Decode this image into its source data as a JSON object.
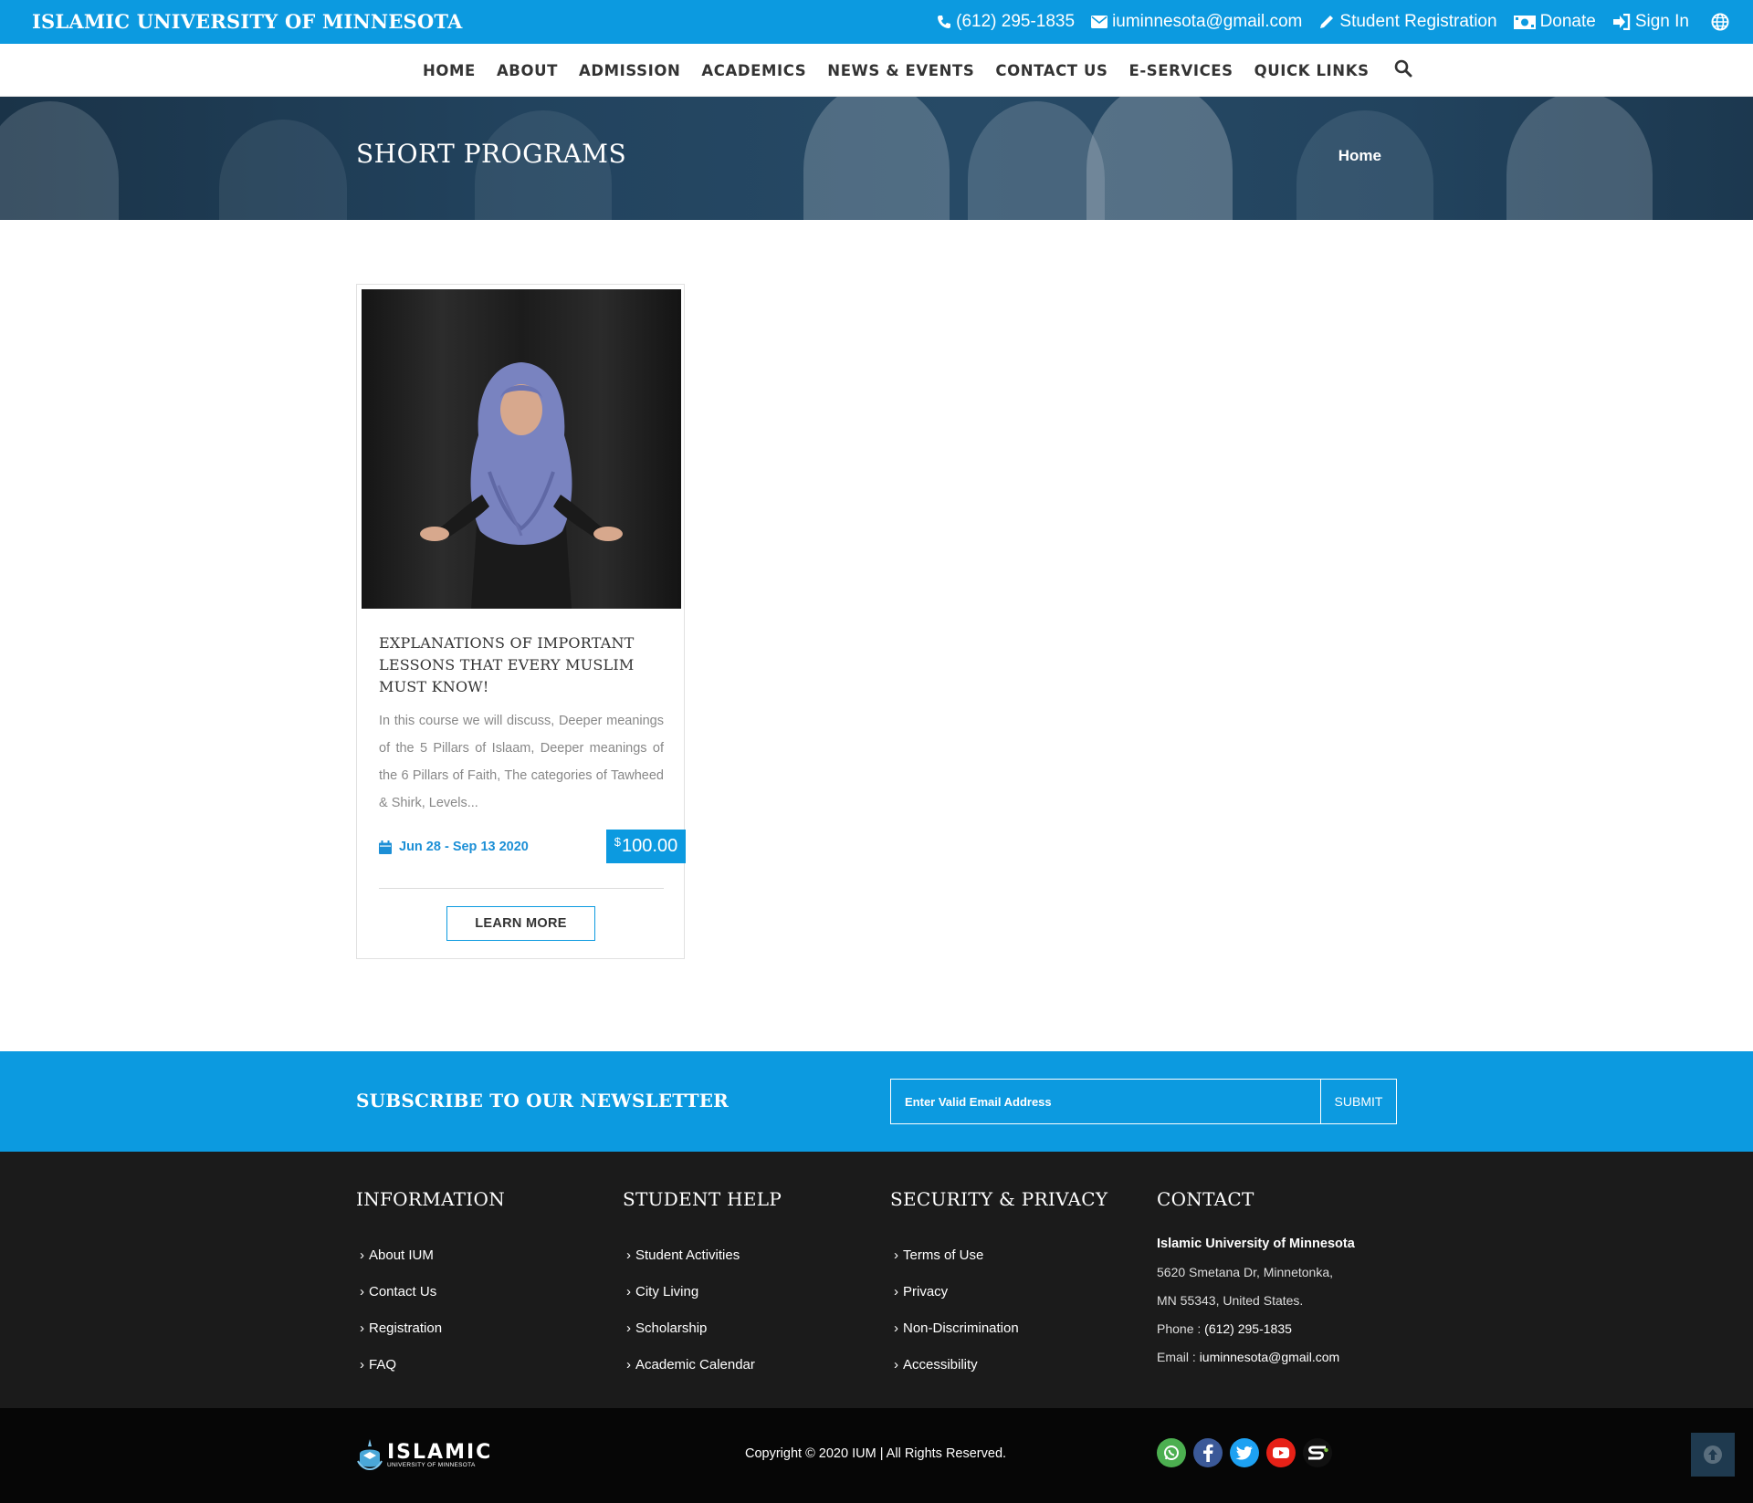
{
  "topbar": {
    "brand": "ISLAMIC UNIVERSITY OF MINNESOTA",
    "phone": "(612) 295-1835",
    "email": "iuminnesota@gmail.com",
    "registration": "Student Registration",
    "donate": "Donate",
    "signin": "Sign In"
  },
  "nav": {
    "items": [
      "HOME",
      "ABOUT",
      "ADMISSION",
      "ACADEMICS",
      "NEWS & EVENTS",
      "CONTACT US",
      "E-SERVICES",
      "QUICK LINKS"
    ]
  },
  "banner": {
    "title": "SHORT PROGRAMS",
    "breadcrumb": "Home"
  },
  "course": {
    "title": "EXPLANATIONS OF IMPORTANT LESSONS THAT EVERY MUSLIM MUST KNOW!",
    "description": "In this course we will discuss, Deeper meanings of the 5 Pillars of Islaam, Deeper meanings of the 6 Pillars of Faith, The categories of Tawheed & Shirk, Levels...",
    "dates": "Jun 28 - Sep 13 2020",
    "currency": "$",
    "price": "100.00",
    "button": "LEARN MORE"
  },
  "newsletter": {
    "title": "SUBSCRIBE TO OUR NEWSLETTER",
    "placeholder": "Enter Valid Email Address",
    "submit": "SUBMIT"
  },
  "footer": {
    "information": {
      "title": "INFORMATION",
      "links": [
        "About IUM",
        "Contact Us",
        "Registration",
        "FAQ"
      ]
    },
    "student_help": {
      "title": "STUDENT HELP",
      "links": [
        "Student Activities",
        "City Living",
        "Scholarship",
        "Academic Calendar"
      ]
    },
    "security": {
      "title": "SECURITY & PRIVACY",
      "links": [
        "Terms of Use",
        "Privacy",
        "Non-Discrimination",
        "Accessibility"
      ]
    },
    "contact": {
      "title": "CONTACT",
      "name": "Islamic University of Minnesota",
      "address1": "5620 Smetana Dr, Minnetonka,",
      "address2": "MN 55343, United States.",
      "phone_label": "Phone :",
      "phone": "(612) 295-1835",
      "email_label": "Email :",
      "email": "iuminnesota@gmail.com"
    }
  },
  "bottom": {
    "logo_word": "ISLAMIC",
    "logo_sub": "UNIVERSITY OF MINNESOTA",
    "copyright": "Copyright © 2020 IUM | All Rights Reserved.",
    "socials": [
      "whatsapp-icon",
      "facebook-icon",
      "twitter-icon",
      "youtube-icon",
      "s-brand-icon"
    ]
  },
  "colors": {
    "brand_blue": "#0c9ae0",
    "footer_dark": "#1b1b1b",
    "bottom_dark": "#060606"
  }
}
